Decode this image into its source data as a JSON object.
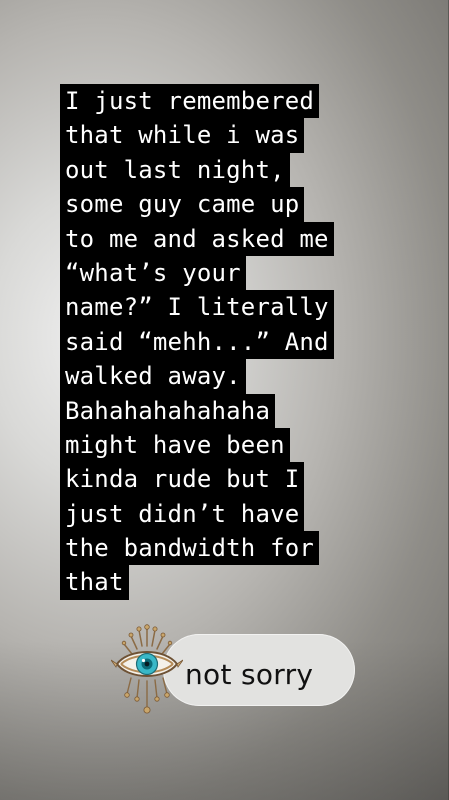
{
  "story": {
    "text_lines": [
      "I just remembered",
      "that while i was",
      "out last night,",
      "some guy came up",
      "to me and asked me",
      "“what’s your",
      "name?” I literally",
      "said “mehh...” And",
      "walked away.",
      "Bahahahahahaha",
      "might have been",
      "kinda rude but I",
      "just didn’t have",
      "the bandwidth for",
      "that"
    ]
  },
  "sticker": {
    "icon": "evil-eye-icon",
    "label": "not sorry"
  }
}
